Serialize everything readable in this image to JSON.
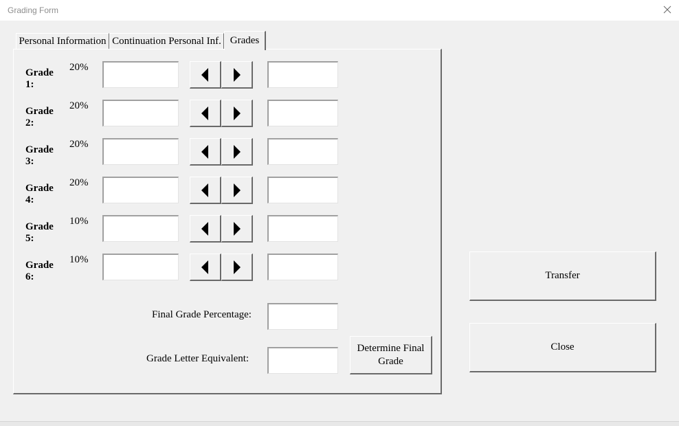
{
  "window": {
    "title": "Grading Form"
  },
  "tabs": [
    {
      "label": "Personal Information"
    },
    {
      "label": "Continuation Personal Inf."
    },
    {
      "label": "Grades",
      "active": true
    }
  ],
  "grades": [
    {
      "label": "Grade 1:",
      "weight": "20%",
      "value": "",
      "result": ""
    },
    {
      "label": "Grade 2:",
      "weight": "20%",
      "value": "",
      "result": ""
    },
    {
      "label": "Grade 3:",
      "weight": "20%",
      "value": "",
      "result": ""
    },
    {
      "label": "Grade 4:",
      "weight": "20%",
      "value": "",
      "result": ""
    },
    {
      "label": "Grade 5:",
      "weight": "10%",
      "value": "",
      "result": ""
    },
    {
      "label": "Grade 6:",
      "weight": "10%",
      "value": "",
      "result": ""
    }
  ],
  "summary": {
    "final_percentage_label": "Final Grade Percentage:",
    "final_percentage_value": "",
    "letter_label": "Grade Letter Equivalent:",
    "letter_value": "",
    "determine_button": "Determine Final Grade"
  },
  "actions": {
    "transfer_label": "Transfer",
    "close_label": "Close"
  },
  "icons": {
    "close": "close-icon",
    "spin_left": "triangle-left-icon",
    "spin_right": "triangle-right-icon"
  }
}
